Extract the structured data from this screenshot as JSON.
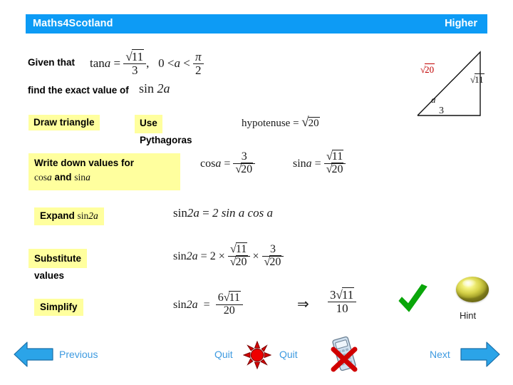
{
  "header": {
    "title": "Maths4Scotland",
    "level": "Higher",
    "band_color": "#0d9bf5"
  },
  "question": {
    "given_label": "Given that",
    "given_equation": "tan a = √11 / 3,  0 < a < π/2",
    "given_tan": "tan",
    "given_var": "a",
    "given_equals": "=",
    "given_num": "11",
    "given_den": "3",
    "given_comma": ",",
    "given_range_left": "0 <",
    "given_range_var": "a",
    "given_range_lt": "<",
    "given_range_num": "π",
    "given_range_den": "2",
    "find_label": "find the exact value of",
    "find_math_sin": "sin",
    "find_math_arg": "2a"
  },
  "triangle": {
    "hypotenuse_label": "20",
    "opposite_label": "11",
    "adjacent_label": "3",
    "angle_label": "a",
    "hypotenuse_color": "#c00000"
  },
  "steps": [
    {
      "id": "draw-triangle",
      "label": "Draw triangle"
    },
    {
      "id": "use-pythagoras",
      "label_line1": "Use",
      "label_line2": "Pythagoras",
      "result_text": "hypotenuse",
      "result_equals": "=",
      "result_radicand": "20"
    },
    {
      "id": "write-values",
      "label_line1": "Write down values for",
      "label_cos": "cos",
      "label_var1": "a",
      "label_and": "and",
      "label_sin": "sin",
      "label_var2": "a",
      "cos_lhs_fn": "cos",
      "cos_lhs_var": "a",
      "cos_equals": "=",
      "cos_num": "3",
      "cos_den_radicand": "20",
      "sin_lhs_fn": "sin",
      "sin_lhs_var": "a",
      "sin_equals": "=",
      "sin_num_radicand": "11",
      "sin_den_radicand": "20"
    },
    {
      "id": "expand",
      "label": "Expand",
      "label_math_fn": "sin",
      "label_math_arg": "2a",
      "eq_lhs_fn": "sin",
      "eq_lhs_arg": "2a",
      "eq_equals": "=",
      "eq_rhs": "2 sin a cos a"
    },
    {
      "id": "substitute",
      "label_line1": "Substitute",
      "label_line2": "values",
      "eq_lhs_fn": "sin",
      "eq_lhs_arg": "2a",
      "eq_equals": "=",
      "eq_coefficient": "2",
      "eq_times1": "×",
      "eq_f1_num_radicand": "11",
      "eq_f1_den_radicand": "20",
      "eq_times2": "×",
      "eq_f2_num": "3",
      "eq_f2_den_radicand": "20"
    },
    {
      "id": "simplify",
      "label": "Simplify",
      "eq_lhs_fn": "sin",
      "eq_lhs_arg": "2a",
      "eq_equals": "=",
      "eq_num_coeff": "6",
      "eq_num_radicand": "11",
      "eq_den": "20",
      "implies_symbol": "⇒",
      "final_num_coeff": "3",
      "final_num_radicand": "11",
      "final_den": "10"
    }
  ],
  "hint": {
    "label": "Hint"
  },
  "nav": {
    "previous_label": "Previous",
    "quit_left_label": "Quit",
    "quit_right_label": "Quit",
    "next_label": "Next",
    "link_color": "#3d9ae0",
    "arrow_color": "#2ba4e8"
  }
}
